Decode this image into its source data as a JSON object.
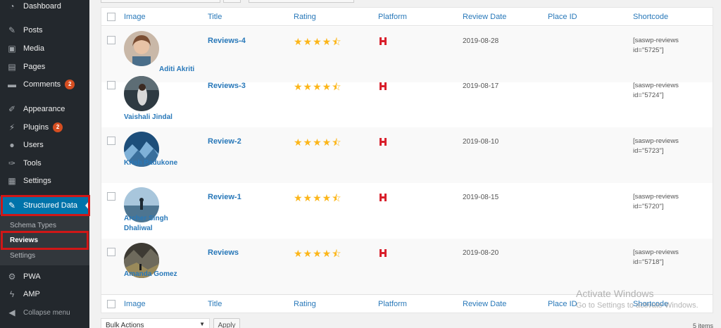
{
  "sidebar": {
    "items": [
      {
        "label": "Dashboard",
        "icon": "dashboard-icon",
        "glyph": "◔",
        "badge": ""
      },
      {
        "label": "Posts",
        "icon": "pin-icon",
        "glyph": "✎",
        "badge": ""
      },
      {
        "label": "Media",
        "icon": "media-icon",
        "glyph": "▣",
        "badge": ""
      },
      {
        "label": "Pages",
        "icon": "pages-icon",
        "glyph": "▤",
        "badge": ""
      },
      {
        "label": "Comments",
        "icon": "comment-icon",
        "glyph": "▬",
        "badge": "2"
      },
      {
        "label": "Appearance",
        "icon": "brush-icon",
        "glyph": "✐",
        "badge": ""
      },
      {
        "label": "Plugins",
        "icon": "plug-icon",
        "glyph": "⚡",
        "badge": "2"
      },
      {
        "label": "Users",
        "icon": "user-icon",
        "glyph": "●",
        "badge": ""
      },
      {
        "label": "Tools",
        "icon": "wrench-icon",
        "glyph": "✑",
        "badge": ""
      },
      {
        "label": "Settings",
        "icon": "settings-icon",
        "glyph": "▦",
        "badge": ""
      },
      {
        "label": "Structured Data",
        "icon": "pushpin-icon",
        "glyph": "✎",
        "badge": ""
      },
      {
        "label": "PWA",
        "icon": "gear-icon",
        "glyph": "⚙",
        "badge": ""
      },
      {
        "label": "AMP",
        "icon": "amp-icon",
        "glyph": "ϟ",
        "badge": ""
      },
      {
        "label": "Collapse menu",
        "icon": "collapse-icon",
        "glyph": "◀",
        "badge": ""
      }
    ],
    "submenu": [
      "Schema Types",
      "Reviews",
      "Settings"
    ]
  },
  "table": {
    "columns": [
      "Image",
      "Title",
      "Rating",
      "Platform",
      "Review Date",
      "Place ID",
      "Shortcode"
    ],
    "rows": [
      {
        "author": "Aditi Akriti",
        "title": "Reviews-4",
        "rating": 4.5,
        "stars": "★★★★⯪",
        "date": "2019-08-28",
        "place_id": "",
        "shortcode_1": "[saswp-reviews",
        "shortcode_2": "id=\"5725\"]"
      },
      {
        "author": "Vaishali Jindal",
        "title": "Reviews-3",
        "rating": 4.5,
        "stars": "★★★★⯪",
        "date": "2019-08-17",
        "place_id": "",
        "shortcode_1": "[saswp-reviews",
        "shortcode_2": "id=\"5724\"]"
      },
      {
        "author": "Krish Padukone",
        "title": "Review-2",
        "rating": 4.5,
        "stars": "★★★★⯪",
        "date": "2019-08-10",
        "place_id": "",
        "shortcode_1": "[saswp-reviews",
        "shortcode_2": "id=\"5723\"]"
      },
      {
        "author": "Archer Singh Dhaliwal",
        "title": "Review-1",
        "rating": 4.5,
        "stars": "★★★★⯪",
        "date": "2019-08-15",
        "place_id": "",
        "shortcode_1": "[saswp-reviews",
        "shortcode_2": "id=\"5720\"]"
      },
      {
        "author": "Amanda Gomez",
        "title": "Reviews",
        "rating": 4.5,
        "stars": "★★★★⯪",
        "date": "2019-08-20",
        "place_id": "",
        "shortcode_1": "[saswp-reviews",
        "shortcode_2": "id=\"5718\"]"
      }
    ]
  },
  "footer": {
    "bulk_actions": "Bulk Actions",
    "apply": "Apply",
    "items_count": "5 items"
  },
  "watermark": {
    "line1": "Activate Windows",
    "line2": "Go to Settings to activate Windows."
  },
  "colors": {
    "sidebar_bg": "#23282d",
    "active_bg": "#0073aa",
    "link": "#2878b9",
    "star": "#fcb61a",
    "badge": "#d54e21",
    "highlight": "#d01717"
  }
}
